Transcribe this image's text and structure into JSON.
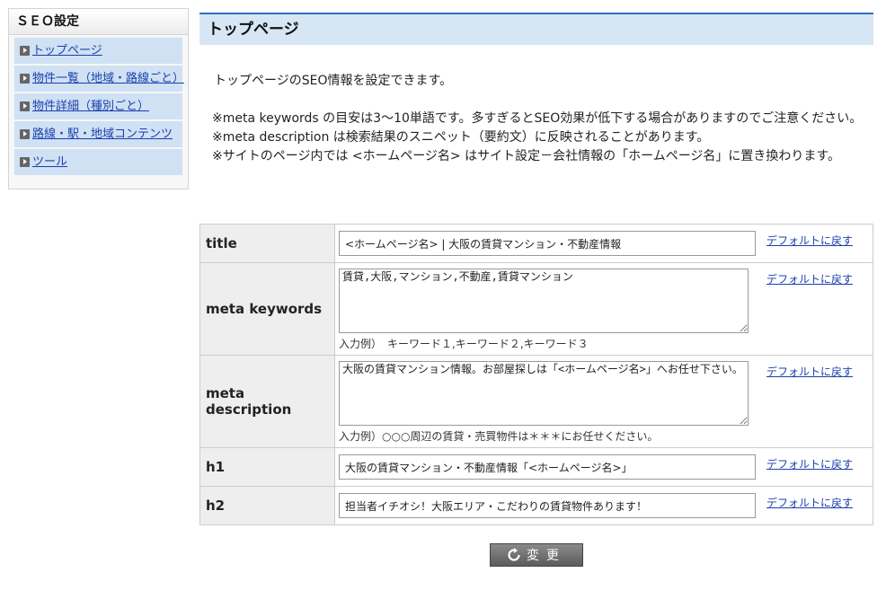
{
  "sidebar": {
    "title": "ＳＥＯ設定",
    "items": [
      {
        "label": "トップページ"
      },
      {
        "label": "物件一覧（地域・路線ごと）"
      },
      {
        "label": "物件詳細（種別ごと）"
      },
      {
        "label": "路線・駅・地域コンテンツ"
      },
      {
        "label": "ツール"
      }
    ]
  },
  "main": {
    "title": "トップページ",
    "intro": "トップページのSEO情報を設定できます。",
    "notes": [
      "※meta keywords の目安は3～10単語です。多すぎるとSEO効果が低下する場合がありますのでご注意ください。",
      "※meta description は検索結果のスニペット（要約文）に反映されることがあります。",
      "※サイトのページ内では <ホームページ名> はサイト設定－会社情報の「ホームページ名」に置き換わります。"
    ]
  },
  "form": {
    "default_link": "デフォルトに戻す",
    "rows": {
      "title": {
        "label": "title",
        "value": "<ホームページ名> | 大阪の賃貸マンション・不動産情報"
      },
      "keywords": {
        "label": "meta keywords",
        "value": "賃貸,大阪,マンション,不動産,賃貸マンション",
        "example": "入力例）　キーワード１,キーワード２,キーワード３"
      },
      "description": {
        "label": "meta description",
        "value": "大阪の賃貸マンション情報。お部屋探しは「<ホームページ名>」へお任せ下さい。",
        "example": "入力例）○○○周辺の賃貸・売買物件は＊＊＊にお任せください。"
      },
      "h1": {
        "label": "h1",
        "value": "大阪の賃貸マンション・不動産情報「<ホームページ名>」"
      },
      "h2": {
        "label": "h2",
        "value": "担当者イチオシ！大阪エリア・こだわりの賃貸物件あります！"
      }
    },
    "submit_label": "変更",
    "submit_icon": "refresh-icon"
  }
}
